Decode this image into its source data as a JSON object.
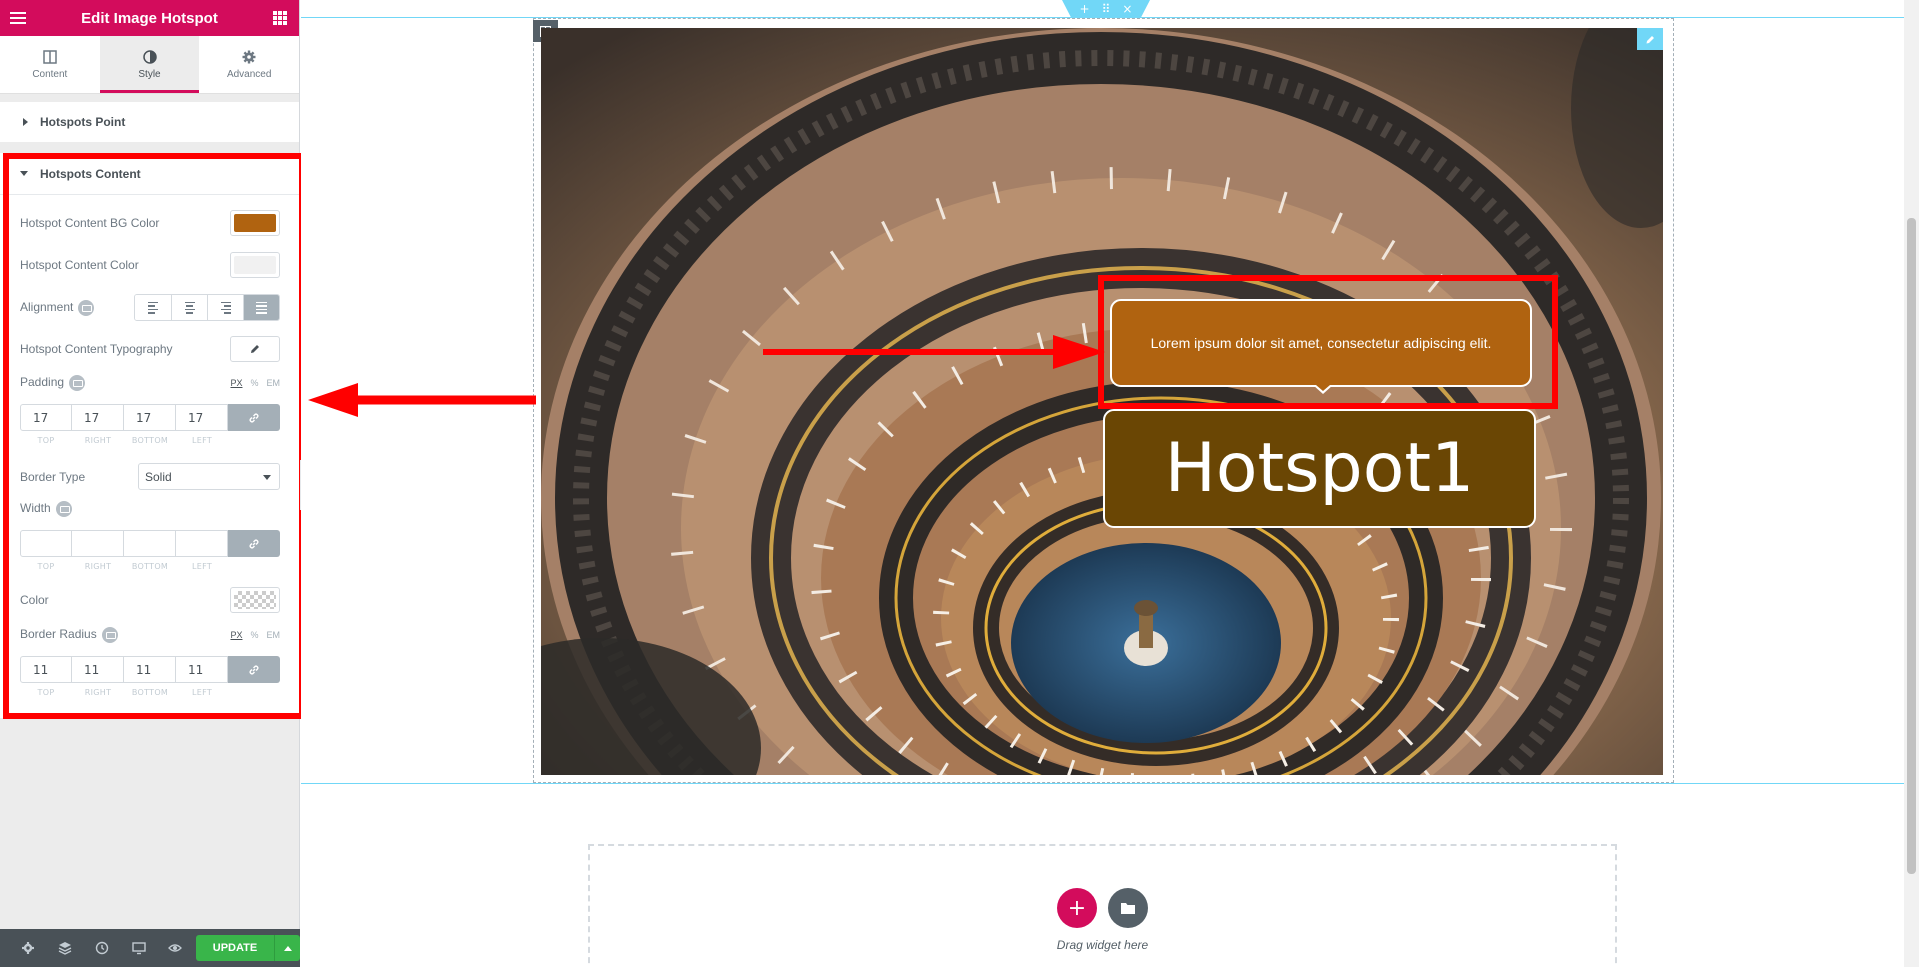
{
  "panel": {
    "title": "Edit Image Hotspot",
    "tabs": [
      {
        "label": "Content",
        "icon": "layout-icon"
      },
      {
        "label": "Style",
        "icon": "half-circle-icon"
      },
      {
        "label": "Advanced",
        "icon": "gear-icon"
      }
    ],
    "active_tab": "Style",
    "sections": {
      "hotspots_point": "Hotspots Point",
      "hotspots_content": "Hotspots Content"
    },
    "controls": {
      "bg_color_label": "Hotspot Content BG Color",
      "bg_color_value": "#b06310",
      "content_color_label": "Hotspot Content Color",
      "content_color_value": "#f1f1f1",
      "alignment_label": "Alignment",
      "alignment_selected": "justify",
      "typography_label": "Hotspot Content Typography",
      "padding_label": "Padding",
      "padding": {
        "top": "17",
        "right": "17",
        "bottom": "17",
        "left": "17"
      },
      "border_type_label": "Border Type",
      "border_type_value": "Solid",
      "width_label": "Width",
      "width": {
        "top": "",
        "right": "",
        "bottom": "",
        "left": ""
      },
      "color_label": "Color",
      "border_radius_label": "Border Radius",
      "border_radius": {
        "top": "11",
        "right": "11",
        "bottom": "11",
        "left": "11"
      },
      "dim_labels": {
        "top": "TOP",
        "right": "RIGHT",
        "bottom": "BOTTOM",
        "left": "LEFT"
      },
      "units": [
        "PX",
        "%",
        "EM"
      ]
    },
    "footer": {
      "update_label": "UPDATE"
    }
  },
  "canvas": {
    "tooltip_text": "Lorem ipsum dolor sit amet, consectetur adipiscing elit.",
    "hotspot_label": "Hotspot1",
    "drop_text": "Drag widget here",
    "handle_icons": [
      "+",
      "⠿",
      "×"
    ]
  },
  "colors": {
    "brand": "#d30c5c",
    "highlight": "#ff0000",
    "hotspot_bg": "#6a4604",
    "tooltip_bg": "#b06310",
    "update_green": "#39b54a"
  }
}
